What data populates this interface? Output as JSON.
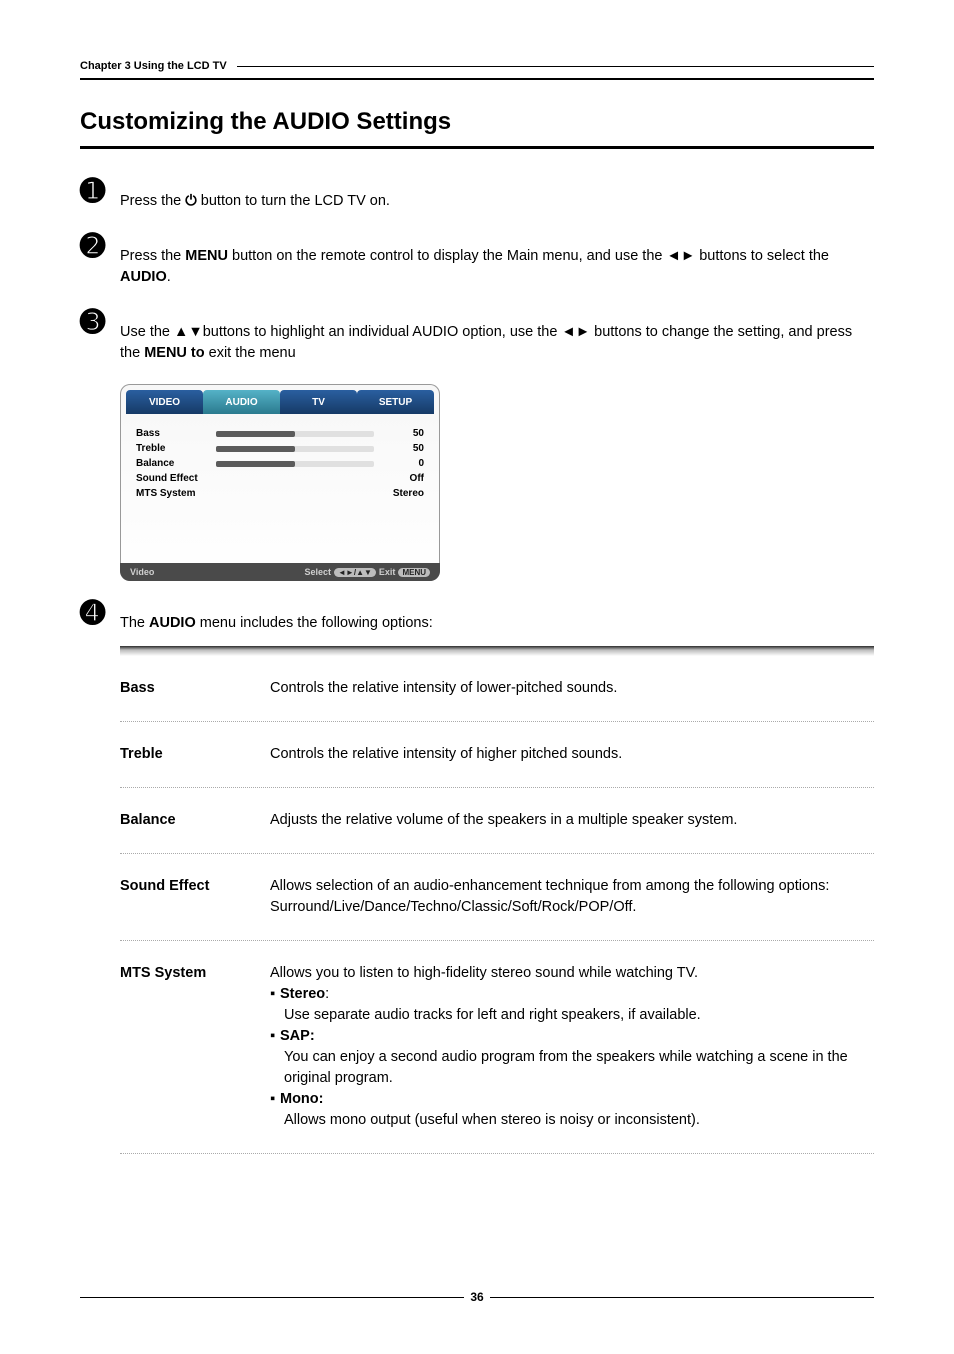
{
  "chapter": "Chapter 3 Using the LCD TV",
  "title": "Customizing the AUDIO Settings",
  "steps": {
    "s1": {
      "pre": "Press the ",
      "post": " button to turn the LCD TV on."
    },
    "s2": {
      "l1_pre": "Press the ",
      "l1_bold": "MENU",
      "l1_mid": " button on the remote control to display the Main menu, and use the ",
      "l2_pre": "◄► buttons to select the ",
      "l2_bold": "AUDIO",
      "l2_post": "."
    },
    "s3": {
      "l1": "Use the ▲▼buttons to highlight an individual AUDIO option, use the ◄► buttons to change the setting, and press the ",
      "bold": "MENU to",
      "post": " exit the menu"
    },
    "s4": {
      "pre": "The ",
      "bold": "AUDIO",
      "post": " menu includes the following options:"
    }
  },
  "osd": {
    "tabs": {
      "video": "VIDEO",
      "audio": "AUDIO",
      "tv": "TV",
      "setup": "SETUP"
    },
    "rows": {
      "bass": {
        "label": "Bass",
        "value": "50",
        "pct": 50
      },
      "treble": {
        "label": "Treble",
        "value": "50",
        "pct": 50
      },
      "balance": {
        "label": "Balance",
        "value": "0",
        "pct": 50
      },
      "sound": {
        "label": "Sound Effect",
        "value": "Off"
      },
      "mts": {
        "label": "MTS System",
        "value": "Stereo"
      }
    },
    "footer": {
      "left": "Video",
      "select": "Select",
      "arrows": "◄►/▲▼",
      "exit": "Exit",
      "menu": "MENU"
    }
  },
  "opts": {
    "bass": {
      "name": "Bass",
      "desc": "Controls the relative intensity of lower-pitched sounds."
    },
    "treble": {
      "name": "Treble",
      "desc": "Controls the relative intensity of higher pitched sounds."
    },
    "balance": {
      "name": "Balance",
      "desc": "Adjusts the relative volume of the speakers in a multiple speaker system."
    },
    "sound": {
      "name": "Sound Effect",
      "desc": "Allows selection of an audio-enhancement technique from among the following options: Surround/Live/Dance/Techno/Classic/Soft/Rock/POP/Off."
    },
    "mts": {
      "name": "MTS System",
      "intro": "Allows you to listen to high-fidelity stereo sound while watching TV.",
      "stereo_h": "Stereo",
      "stereo_d": "Use separate audio tracks for left and right speakers, if available.",
      "sap_h": "SAP:",
      "sap_d": "You can enjoy a second audio program from the speakers while watching a scene in the original program.",
      "mono_h": "Mono:",
      "mono_d": "Allows mono output (useful when stereo is noisy or inconsistent)."
    }
  },
  "page_number": "36"
}
